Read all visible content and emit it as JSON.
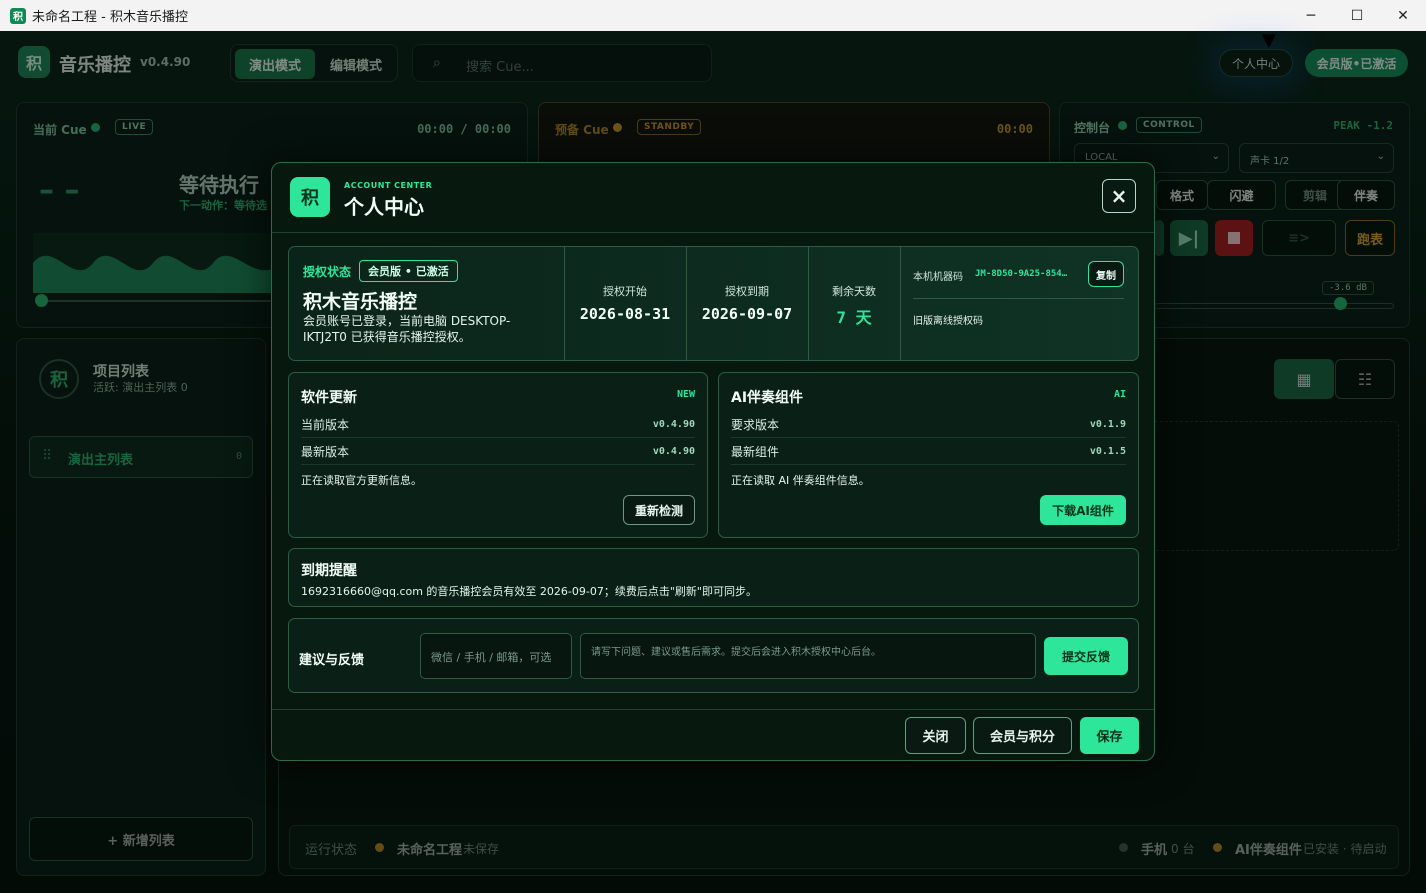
{
  "window": {
    "title": "未命名工程 - 积木音乐播控",
    "app_icon": "积"
  },
  "header": {
    "logo": "积",
    "brand": "音乐播控",
    "version": "v0.4.90",
    "modes": [
      "演出模式",
      "编辑模式"
    ],
    "search_placeholder": "搜索 Cue...",
    "account_button": "个人中心",
    "member_button": "会员版•已激活"
  },
  "current_cue": {
    "label": "当前 Cue",
    "badge": "LIVE",
    "time": "00:00 / 00:00",
    "dashes": "– –",
    "status": "等待执行",
    "next": "下一动作：等待选"
  },
  "standby_cue": {
    "label": "预备 Cue",
    "badge": "STANDBY",
    "time": "00:00"
  },
  "control": {
    "label": "控制台",
    "badge": "CONTROL",
    "peak": "PEAK -1.2",
    "output": "LOCAL",
    "card": "声卡 1/2",
    "buttons": [
      "格式",
      "闪避",
      "剪辑",
      "伴奏"
    ],
    "run": "跑表",
    "db": "-3.6 dB"
  },
  "sidebar": {
    "avatar": "积",
    "title": "项目列表",
    "subtitle": "活跃: 演出主列表 0",
    "item": "演出主列表",
    "item_count": "0",
    "add": "+ 新增列表"
  },
  "statusbar": {
    "label": "运行状态",
    "project": "未命名工程",
    "saved": "未保存",
    "phone": "手机",
    "phone_count": "0 台",
    "ai": "AI伴奏组件",
    "ai_state": "已安装 · 待启动"
  },
  "modal": {
    "logo": "积",
    "kicker": "ACCOUNT CENTER",
    "title": "个人中心",
    "close_icon": "×",
    "license": {
      "label": "授权状态",
      "badge": "会员版 • 已激活",
      "product": "积木音乐播控",
      "desc": "会员账号已登录，当前电脑 DESKTOP-IKTJ2T0 已获得音乐播控授权。",
      "start_label": "授权开始",
      "start": "2026-08-31",
      "end_label": "授权到期",
      "end": "2026-09-07",
      "days_label": "剩余天数",
      "days": "7 天",
      "machine_label": "本机机器码",
      "machine": "JM-8D50-9A25-854…",
      "copy": "复制",
      "legacy": "旧版离线授权码"
    },
    "update": {
      "title": "软件更新",
      "badge": "NEW",
      "current_label": "当前版本",
      "current": "v0.4.90",
      "latest_label": "最新版本",
      "latest": "v0.4.90",
      "note": "正在读取官方更新信息。",
      "button": "重新检测"
    },
    "ai": {
      "title": "AI伴奏组件",
      "badge": "AI",
      "req_label": "要求版本",
      "req": "v0.1.9",
      "latest_label": "最新组件",
      "latest": "v0.1.5",
      "note": "正在读取 AI 伴奏组件信息。",
      "button": "下载AI组件"
    },
    "expiry": {
      "title": "到期提醒",
      "text": "1692316660@qq.com 的音乐播控会员有效至 2026-09-07；续费后点击\"刷新\"即可同步。"
    },
    "feedback": {
      "label": "建议与反馈",
      "contact_placeholder": "微信 / 手机 / 邮箱，可选",
      "content_placeholder": "请写下问题、建议或售后需求。提交后会进入积木授权中心后台。",
      "submit": "提交反馈"
    },
    "footer": {
      "close": "关闭",
      "member": "会员与积分",
      "save": "保存"
    }
  },
  "colors": {
    "accent": "#2ee69a",
    "warn": "#d9a72e",
    "danger": "#c9302c"
  }
}
